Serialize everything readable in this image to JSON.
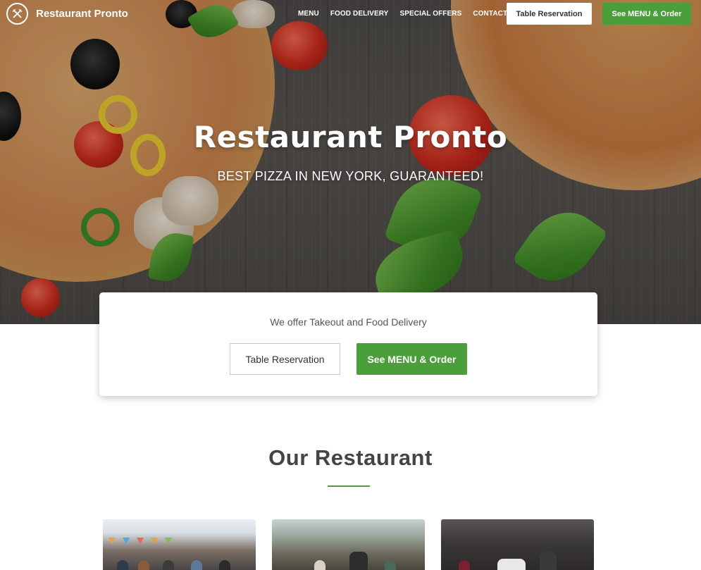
{
  "brand": {
    "name": "Restaurant Pronto"
  },
  "nav": {
    "links": [
      "MENU",
      "FOOD DELIVERY",
      "SPECIAL OFFERS",
      "CONTACT US"
    ],
    "reservation_label": "Table Reservation",
    "order_label": "See MENU & Order"
  },
  "hero": {
    "title": "Restaurant Pronto",
    "subtitle": "BEST PIZZA IN NEW YORK, GUARANTEED!"
  },
  "cta": {
    "text": "We offer Takeout and Food Delivery",
    "reservation_label": "Table Reservation",
    "order_label": "See MENU & Order"
  },
  "section": {
    "title": "Our Restaurant"
  },
  "colors": {
    "accent": "#4a9f3a",
    "text": "#444444",
    "white": "#ffffff"
  },
  "icons": [
    "restaurant-logo-icon"
  ]
}
